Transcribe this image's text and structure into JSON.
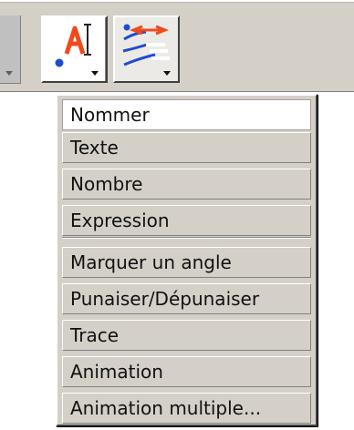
{
  "toolbar": {
    "text_tool_icon": "text-label-icon",
    "locus_tool_icon": "trace-locus-icon",
    "text_tool_glyph": "A"
  },
  "menu": {
    "items": [
      {
        "label": "Nommer",
        "selected": true
      },
      {
        "label": "Texte",
        "selected": false
      },
      {
        "label": "Nombre",
        "selected": false
      },
      {
        "label": "Expression",
        "selected": false
      },
      {
        "label": "Marquer un angle",
        "selected": false
      },
      {
        "label": "Punaiser/Dépunaiser",
        "selected": false
      },
      {
        "label": "Trace",
        "selected": false
      },
      {
        "label": "Animation",
        "selected": false
      },
      {
        "label": "Animation multiple...",
        "selected": false
      }
    ]
  },
  "colors": {
    "toolbar_bg": "#d4d0c8",
    "menu_bg": "#d4d0c8",
    "accent_red": "#f04a1c",
    "accent_blue": "#1f4ccf"
  }
}
